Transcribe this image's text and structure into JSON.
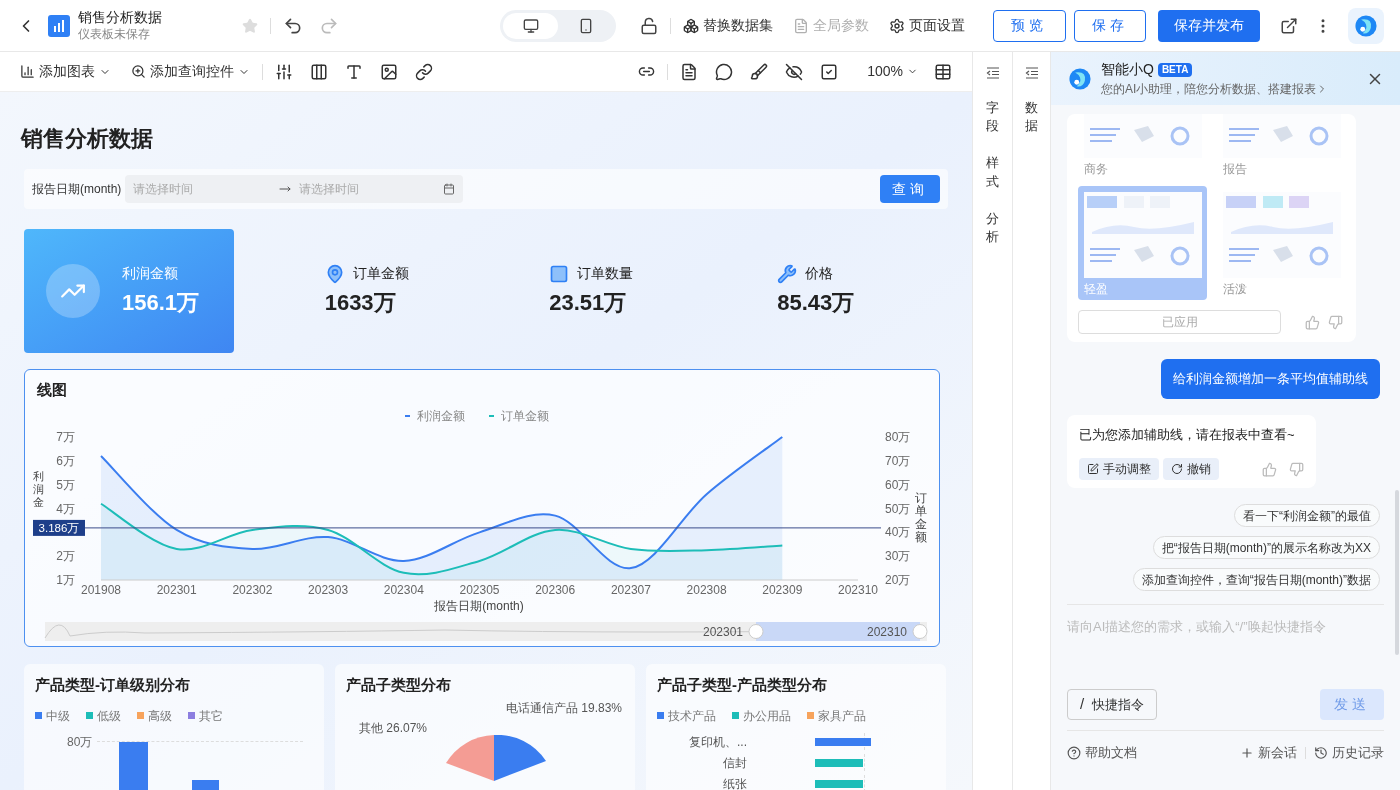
{
  "header": {
    "title": "销售分析数据",
    "subtitle": "仪表板未保存"
  },
  "devices": [
    {
      "kind": "desktop",
      "selected": true
    },
    {
      "kind": "mobile",
      "selected": false
    }
  ],
  "actions": [
    {
      "label": "替换数据集",
      "disabled": false
    },
    {
      "label": "全局参数",
      "disabled": true
    },
    {
      "label": "页面设置",
      "disabled": false
    }
  ],
  "buttons": [
    {
      "label": "预览",
      "kind": "outline"
    },
    {
      "label": "保存",
      "kind": "outline"
    },
    {
      "label": "保存并发布",
      "kind": "primary"
    }
  ],
  "toolbar": {
    "add_chart": "添加图表",
    "add_filter": "添加查询控件",
    "zoom": "100%"
  },
  "side_tabs": [
    {
      "label": "字段"
    },
    {
      "label": "样式"
    },
    {
      "label": "分析"
    }
  ],
  "data_tab": {
    "label": "数据"
  },
  "canvas": {
    "title": "销售分析数据",
    "filter": {
      "label": "报告日期(month)",
      "start_placeholder": "请选择时间",
      "end_placeholder": "请选择时间",
      "button": "查询"
    },
    "kpis": [
      {
        "label": "利润金额",
        "value": "156.1万",
        "highlighted": true
      },
      {
        "label": "订单金额",
        "value": "1633万",
        "highlighted": false
      },
      {
        "label": "订单数量",
        "value": "23.51万",
        "highlighted": false
      },
      {
        "label": "价格",
        "value": "85.43万",
        "highlighted": false
      }
    ],
    "line_chart": {
      "title": "线图",
      "zoom_range": {
        "start": "202301",
        "end": "202310"
      },
      "chart_data": {
        "type": "area",
        "legend": "top",
        "xlabel": "报告日期(month)",
        "ylabel": "利润金",
        "y2label": "订单金额",
        "categories": [
          "201908",
          "202301",
          "202302",
          "202303",
          "202304",
          "202305",
          "202306",
          "202307",
          "202308",
          "202309",
          "202310"
        ],
        "series": [
          {
            "name": "利润金额",
            "color": "#3a7df0",
            "values": [
              6.2,
              3.1,
              2.3,
              2.8,
              1.8,
              3.0,
              3.7,
              1.5,
              4.6,
              7.0,
              null
            ]
          },
          {
            "name": "订单金额",
            "color": "#1dbdb8",
            "axis": "y2",
            "values": [
              52,
              33,
              41,
              41,
              23,
              28,
              41,
              33,
              32.5,
              34.5,
              null
            ]
          }
        ],
        "ylim": [
          1,
          7
        ],
        "y2lim": [
          20,
          80
        ],
        "yticks": [
          {
            "value": 1,
            "label": "1万"
          },
          {
            "value": 2,
            "label": "2万"
          },
          {
            "value": 4,
            "label": "4万"
          },
          {
            "value": 5,
            "label": "5万"
          },
          {
            "value": 6,
            "label": "6万"
          },
          {
            "value": 7,
            "label": "7万"
          }
        ],
        "y2ticks": [
          {
            "value": 20,
            "label": "20万"
          },
          {
            "value": 30,
            "label": "30万"
          },
          {
            "value": 40,
            "label": "40万"
          },
          {
            "value": 50,
            "label": "50万"
          },
          {
            "value": 60,
            "label": "60万"
          },
          {
            "value": 70,
            "label": "70万"
          },
          {
            "value": 80,
            "label": "80万"
          }
        ],
        "ref_lines": [
          {
            "axis": "y",
            "value": 3.186,
            "label": "3.186万"
          }
        ]
      }
    },
    "cards": [
      {
        "kind": "bar",
        "title": "产品类型-订单级别分布",
        "legend": [
          {
            "label": "中级",
            "color": "#3a7df0"
          },
          {
            "label": "低级",
            "color": "#1dbdb8"
          },
          {
            "label": "高级",
            "color": "#f7a35c"
          },
          {
            "label": "其它",
            "color": "#8c7ee0"
          }
        ],
        "labels": [
          "80万"
        ]
      },
      {
        "kind": "pie",
        "title": "产品子类型分布",
        "labels": [
          "其他 26.07%",
          "电话通信产品 19.83%"
        ]
      },
      {
        "kind": "hbar",
        "title": "产品子类型-产品类型分布",
        "legend": [
          {
            "label": "技术产品",
            "color": "#3a7df0"
          },
          {
            "label": "办公用品",
            "color": "#1dbdb8"
          },
          {
            "label": "家具产品",
            "color": "#f7a35c"
          }
        ],
        "labels": [
          "复印机、...",
          "信封",
          "纸张"
        ]
      }
    ]
  },
  "assistant": {
    "name": "智能小Q",
    "badge": "BETA",
    "tagline": "您的AI小助理，陪您分析数据、搭建报表",
    "templates": [
      {
        "label": "商务",
        "selected": false
      },
      {
        "label": "报告",
        "selected": false
      },
      {
        "label": "轻盈",
        "selected": true
      },
      {
        "label": "活泼",
        "selected": false
      }
    ],
    "applied_button": "已应用",
    "user_message": "给利润金额增加一条平均值辅助线",
    "reply": {
      "text": "已为您添加辅助线，请在报表中查看~",
      "actions": [
        "手动调整",
        "撤销"
      ]
    },
    "suggestions": [
      "看一下“利润金额”的最值",
      "把“报告日期(month)”的展示名称改为XX",
      "添加查询控件，查询“报告日期(month)”数据"
    ],
    "input": {
      "placeholder": "请向AI描述您的需求，或输入“/”唤起快捷指令"
    },
    "shortcut": {
      "prefix": "/",
      "label": "快捷指令"
    },
    "send": {
      "label": "发送",
      "disabled": true
    },
    "footer": [
      "帮助文档",
      "新会话",
      "历史记录"
    ]
  }
}
